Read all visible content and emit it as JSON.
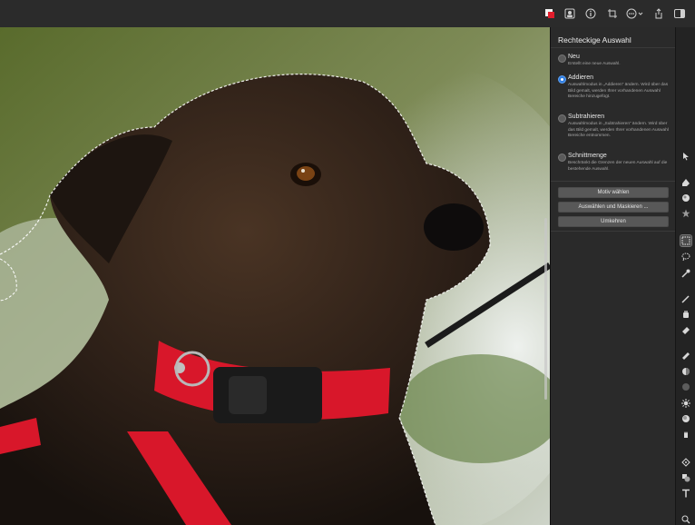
{
  "toolbar": {
    "icons": [
      "color-swatch-icon",
      "portrait-icon",
      "info-icon",
      "crop-rotate-icon",
      "more-options-icon",
      "share-icon",
      "sidebar-toggle-icon"
    ]
  },
  "panel": {
    "title": "Rechteckige Auswahl",
    "options": [
      {
        "label": "Neu",
        "desc": "Erstellt eine neue Auswahl.",
        "selected": false
      },
      {
        "label": "Addieren",
        "desc": "Auswahlmodus in „Addieren“ ändern. Wird über das Bild gemalt, werden Ihrer vorhandenen Auswahl Bereiche hinzugefügt.",
        "selected": true
      },
      {
        "label": "Subtrahieren",
        "desc": "Auswahlmodus in „Subtrahieren“ ändern. Wird über das Bild gemalt, werden Ihrer vorhandenen Auswahl Bereiche entnommen.",
        "selected": false
      },
      {
        "label": "Schnittmenge",
        "desc": "Beschränkt die Grenzen der neuen Auswahl auf die bestehende Auswahl.",
        "selected": false
      }
    ],
    "buttons": {
      "select_subject": "Motiv wählen",
      "select_and_mask": "Auswählen und Maskieren ...",
      "invert": "Umkehren"
    }
  },
  "tools": [
    "pointer-icon",
    "pen-icon",
    "blob-icon",
    "star-icon",
    "rect-select-icon",
    "lasso-icon",
    "magic-brush-icon",
    "brush-icon",
    "bucket-icon",
    "eraser-icon",
    "bandage-icon",
    "stamp-icon",
    "sphere-icon",
    "sun-icon",
    "burn-icon",
    "smudge-icon",
    "vector-pen-icon",
    "shapes-icon",
    "text-icon",
    "zoom-icon"
  ],
  "colors": {
    "accent": "#2f7de1",
    "collar_red": "#d8172a",
    "panel_bg": "#2a2a2a"
  }
}
